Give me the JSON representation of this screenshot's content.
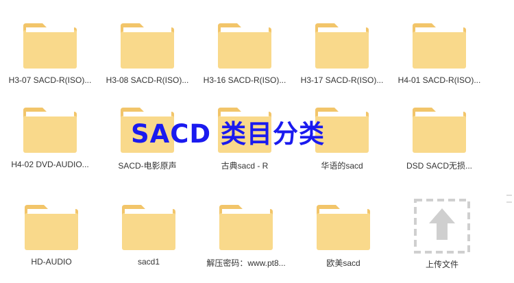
{
  "overlay": {
    "title": "SACD 类目分类"
  },
  "colors": {
    "folder_body": "#f9d98b",
    "folder_back": "#f2c56a",
    "folder_paper": "#ffffff",
    "title_blue": "#1a1aef"
  },
  "folders": [
    {
      "name": "H3-07 SACD-R(ISO)...",
      "icon": "folder-icon"
    },
    {
      "name": "H3-08 SACD-R(ISO)...",
      "icon": "folder-icon"
    },
    {
      "name": "H3-16 SACD-R(ISO)...",
      "icon": "folder-icon"
    },
    {
      "name": "H3-17 SACD-R(ISO)...",
      "icon": "folder-icon"
    },
    {
      "name": "H4-01 SACD-R(ISO)...",
      "icon": "folder-icon"
    },
    {
      "name": "H4-02 DVD-AUDIO...",
      "icon": "folder-icon"
    },
    {
      "name": "SACD-电影原声",
      "icon": "folder-icon"
    },
    {
      "name": "古典sacd - R",
      "icon": "folder-icon"
    },
    {
      "name": "华语的sacd",
      "icon": "folder-icon"
    },
    {
      "name": "DSD SACD无损...",
      "icon": "folder-icon"
    },
    {
      "name": "HD-AUDIO",
      "icon": "folder-icon"
    },
    {
      "name": "sacd1",
      "icon": "folder-icon"
    },
    {
      "name": "解压密码：www.pt8...",
      "icon": "folder-icon"
    },
    {
      "name": "欧美sacd",
      "icon": "folder-icon"
    }
  ],
  "upload": {
    "label": "上传文件",
    "icon": "upload-arrow-icon"
  }
}
